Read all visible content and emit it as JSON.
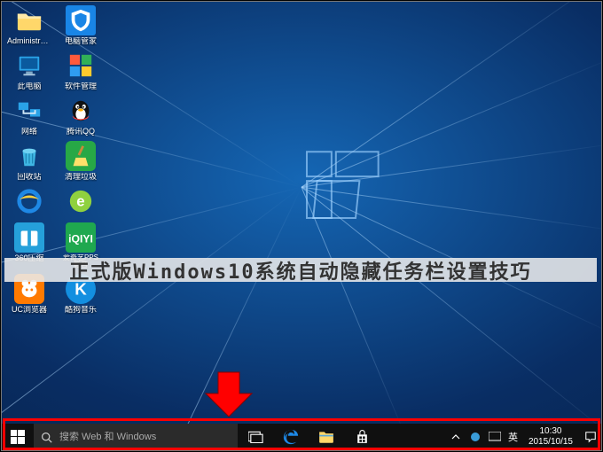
{
  "overlay_text": "正式版Windows10系统自动隐藏任务栏设置技巧",
  "desktop": {
    "icons": [
      [
        {
          "label": "Administrat...",
          "name": "user-folder-icon",
          "bg": "transparent"
        },
        {
          "label": "电脑管家",
          "name": "pc-manager-icon",
          "bg": "#1985e6"
        }
      ],
      [
        {
          "label": "此电脑",
          "name": "this-pc-icon",
          "bg": "transparent"
        },
        {
          "label": "软件管理",
          "name": "software-mgr-icon",
          "bg": "transparent"
        }
      ],
      [
        {
          "label": "网络",
          "name": "network-icon",
          "bg": "transparent"
        },
        {
          "label": "腾讯QQ",
          "name": "qq-icon",
          "bg": "transparent"
        }
      ],
      [
        {
          "label": "回收站",
          "name": "recycle-bin-icon",
          "bg": "transparent"
        },
        {
          "label": "清理垃圾",
          "name": "cleanup-icon",
          "bg": "#27a846"
        }
      ],
      [
        {
          "label": "",
          "name": "ie-icon",
          "bg": "transparent"
        },
        {
          "label": "",
          "name": "browser-icon",
          "bg": "transparent"
        }
      ],
      [
        {
          "label": "360压缩",
          "name": "360zip-icon",
          "bg": "#25a0da"
        },
        {
          "label": "爱奇艺PPS 影音",
          "name": "iqiyi-icon",
          "bg": "#1fa84f"
        }
      ],
      [
        {
          "label": "UC浏览器",
          "name": "uc-browser-icon",
          "bg": "#ff7a00"
        },
        {
          "label": "酷狗音乐",
          "name": "kugou-icon",
          "bg": "#138fe0"
        }
      ]
    ]
  },
  "search_placeholder": "搜索 Web 和 Windows",
  "ime_label": "英",
  "clock": {
    "time": "10:30",
    "date": "2015/10/15"
  }
}
